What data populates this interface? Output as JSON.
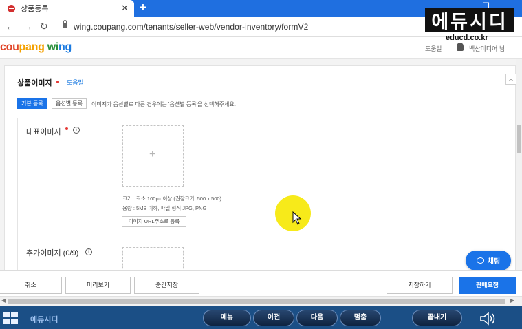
{
  "browser": {
    "tab_title": "상품등록",
    "tab_close": "✕",
    "new_tab": "+",
    "url": "wing.coupang.com/tenants/seller-web/vendor-inventory/formV2"
  },
  "watermark": {
    "logo_text": "에듀시디",
    "site": "educd.co.kr"
  },
  "app": {
    "brand_part1": "cou",
    "brand_part2": "pang",
    "brand_part3": " wi",
    "brand_part4": "ng",
    "header_left_item": "도움말",
    "header_right_item": "백산미디어 님"
  },
  "product_image": {
    "section_title": "상품이미지",
    "help_link": "도움말",
    "tab_basic": "기본 등록",
    "tab_option": "옵션별 등록",
    "option_hint": "이미지가 옵션별로 다른 경우에는 '옵션별 등록'을 선택해주세요.",
    "main_image_label": "대표이미지",
    "size_note": "크기 : 최소 100px 이상 (권장크기: 500 x 500)",
    "format_note": "용량 : 5MB 이하, 파일 형식 JPG, PNG",
    "url_button": "이미지 URL주소로 등록",
    "extra_image_label": "추가이미지 (0/9)",
    "info_glyph": "i",
    "plus_glyph": "+",
    "collapse_glyph": "︿"
  },
  "chat": {
    "label": "채팅"
  },
  "actions": {
    "cancel": "취소",
    "preview": "미리보기",
    "temp_save": "중간저장",
    "save": "저장하기",
    "submit": "판매요청"
  },
  "taskbar": {
    "app_title": "에듀시디",
    "menu": "메뉴",
    "prev": "이전",
    "next": "다음",
    "stop": "멈춤",
    "exit": "끝내기"
  },
  "colors": {
    "accent": "#1a73e8",
    "taskbar": "#1b4f86",
    "required": "#e53935",
    "tabbar": "#1f6fe0"
  }
}
